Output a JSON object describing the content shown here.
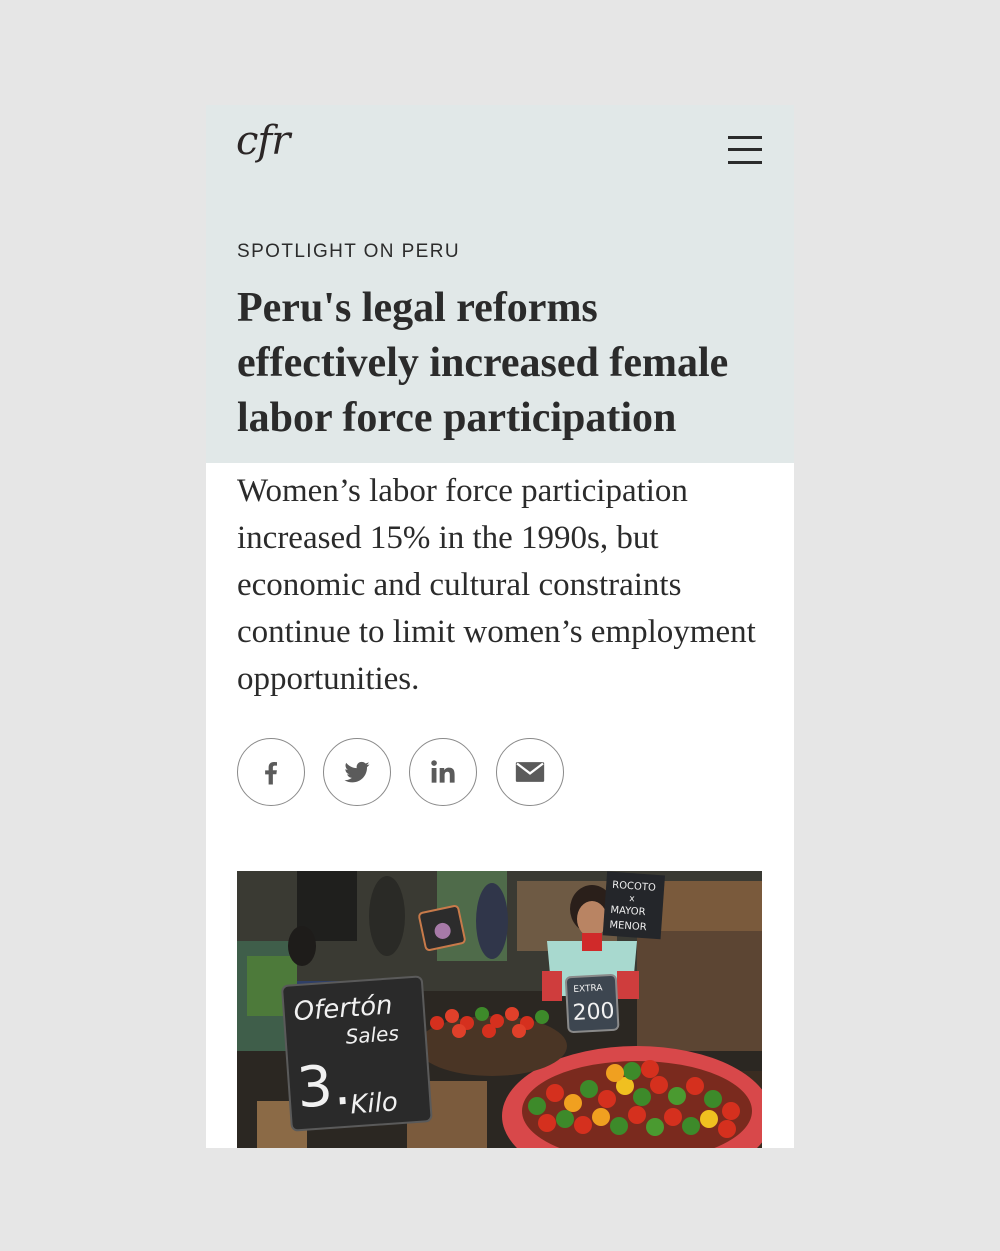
{
  "header": {
    "logo": "cfr",
    "menu_icon": "hamburger-menu-icon"
  },
  "article": {
    "kicker": "SPOTLIGHT ON PERU",
    "title": "Peru's legal reforms effectively increased female labor force participation",
    "dek": "Women’s labor force participation increased 15% in the 1990s, but economic and cultural constraints continue to limit women’s employment opportunities."
  },
  "share": [
    {
      "icon": "facebook-icon"
    },
    {
      "icon": "twitter-icon"
    },
    {
      "icon": "linkedin-icon"
    },
    {
      "icon": "email-icon"
    }
  ],
  "photo": {
    "signs": {
      "main_line1": "Ofertón",
      "main_line2": "Sales",
      "main_price": "3.",
      "main_unit": "Kilo",
      "price_small_top": "EXTRA",
      "price_small": "200",
      "rocoto_1": "ROCOTO",
      "rocoto_2": "x",
      "rocoto_3": "MAYOR",
      "rocoto_4": "MENOR"
    }
  }
}
